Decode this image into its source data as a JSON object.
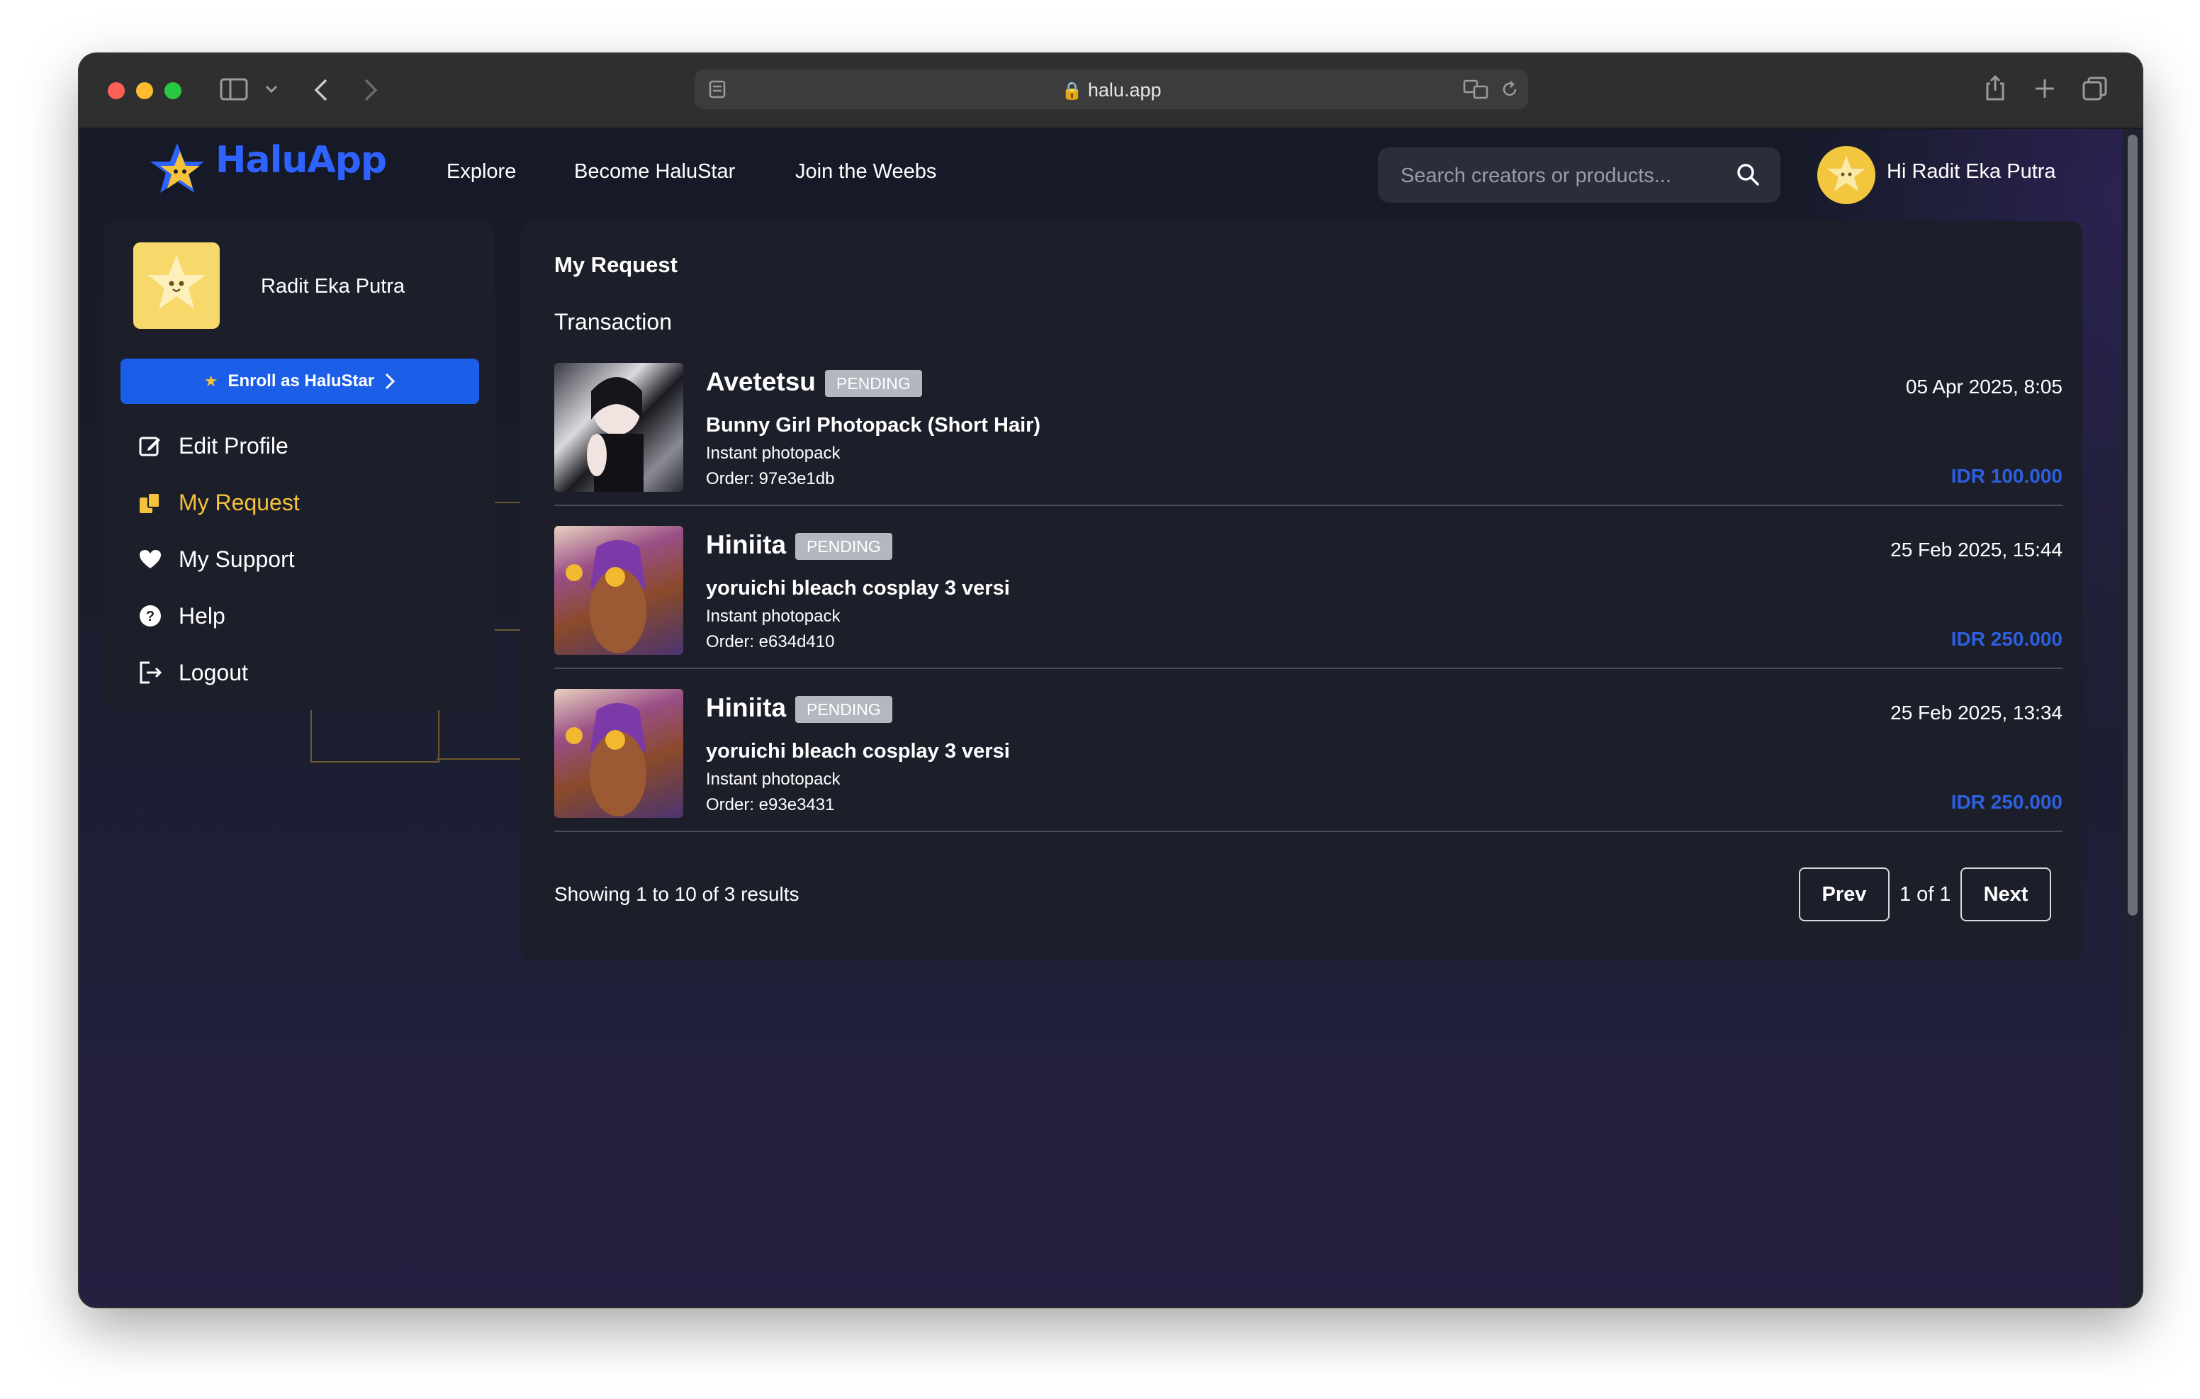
{
  "browser": {
    "url": "halu.app"
  },
  "brand": {
    "name": "HaluApp"
  },
  "nav": {
    "links": [
      "Explore",
      "Become HaluStar",
      "Join the Weebs"
    ],
    "search_placeholder": "Search creators or products...",
    "greeting": "Hi Radit Eka Putra"
  },
  "sidebar": {
    "user_name": "Radit Eka Putra",
    "enroll_label": "Enroll as HaluStar",
    "items": [
      {
        "label": "Edit Profile",
        "icon": "edit-icon"
      },
      {
        "label": "My Request",
        "icon": "request-icon",
        "active": true
      },
      {
        "label": "My Support",
        "icon": "heart-icon"
      },
      {
        "label": "Help",
        "icon": "question-icon"
      },
      {
        "label": "Logout",
        "icon": "logout-icon"
      }
    ]
  },
  "main": {
    "title": "My Request",
    "section": "Transaction",
    "transactions": [
      {
        "creator": "Avetetsu",
        "status": "PENDING",
        "product": "Bunny Girl Photopack (Short Hair)",
        "type": "Instant photopack",
        "order": "Order: 97e3e1db",
        "date": "05 Apr 2025, 8:05",
        "price": "IDR 100.000"
      },
      {
        "creator": "Hiniita",
        "status": "PENDING",
        "product": "yoruichi bleach cosplay 3 versi",
        "type": "Instant photopack",
        "order": "Order: e634d410",
        "date": "25 Feb 2025, 15:44",
        "price": "IDR 250.000"
      },
      {
        "creator": "Hiniita",
        "status": "PENDING",
        "product": "yoruichi bleach cosplay 3 versi",
        "type": "Instant photopack",
        "order": "Order: e93e3431",
        "date": "25 Feb 2025, 13:34",
        "price": "IDR 250.000"
      }
    ],
    "pagination": {
      "summary": "Showing 1 to 10 of 3 results",
      "prev": "Prev",
      "page": "1 of 1",
      "next": "Next"
    }
  },
  "colors": {
    "accent_blue": "#1b5ee8",
    "active_yellow": "#f6c23c",
    "price_blue": "#2d5fe0",
    "badge_gray": "#b4b7bf"
  }
}
